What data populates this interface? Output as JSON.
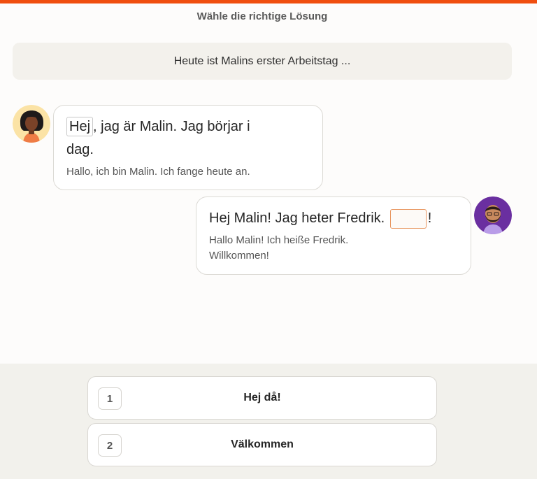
{
  "header": {
    "instruction": "Wähle die richtige Lösung",
    "accent_color": "#f04e0f"
  },
  "context": {
    "text": "Heute ist Malins erster Arbeitstag ..."
  },
  "messages": [
    {
      "speaker_avatar": "woman-avatar-icon",
      "word_highlight": "Hej",
      "swedish_rest_line1": ", jag är Malin. Jag börjar i",
      "swedish_line2": "dag.",
      "german": "Hallo, ich bin Malin. Ich fange heute an."
    },
    {
      "speaker_avatar": "bearded-man-avatar-icon",
      "swedish_before_blank": "Hej Malin! Jag heter Fredrik.",
      "swedish_after_blank": "!",
      "german_line1": "Hallo Malin! Ich heiße Fredrik.",
      "german_line2": "Willkommen!"
    }
  ],
  "options": [
    {
      "number": "1",
      "label": "Hej då!"
    },
    {
      "number": "2",
      "label": "Välkommen"
    }
  ]
}
